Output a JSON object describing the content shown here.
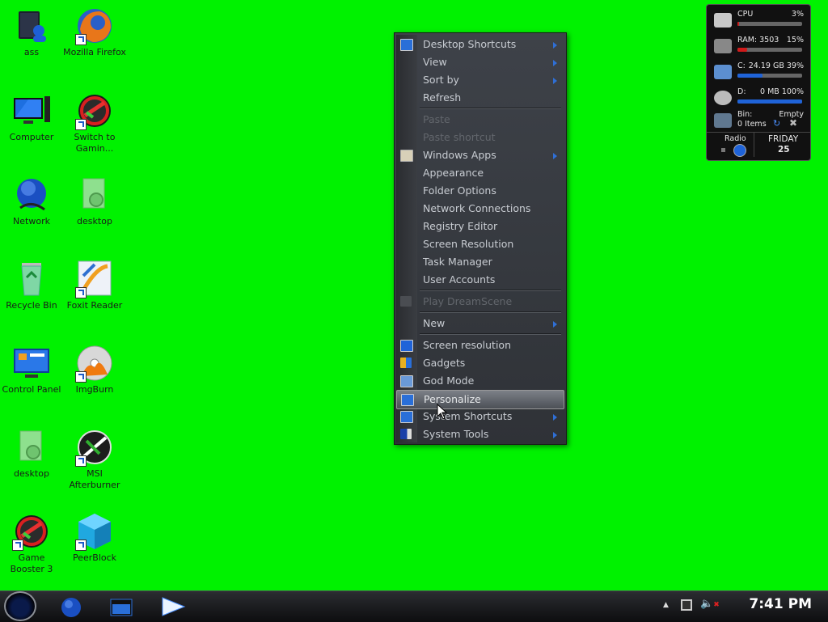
{
  "desktop_icons": [
    {
      "id": "ass",
      "label": "ass",
      "icon": "user-folder-icon",
      "shortcut": false
    },
    {
      "id": "mozilla-firefox",
      "label": "Mozilla Firefox",
      "icon": "firefox-icon",
      "shortcut": true
    },
    {
      "id": "computer",
      "label": "Computer",
      "icon": "computer-icon",
      "shortcut": false
    },
    {
      "id": "switch-to-gaming",
      "label": "Switch to Gamin...",
      "icon": "game-booster-icon",
      "shortcut": true
    },
    {
      "id": "network",
      "label": "Network",
      "icon": "network-globe-icon",
      "shortcut": false
    },
    {
      "id": "desktop-1",
      "label": "desktop",
      "icon": "gear-file-icon",
      "shortcut": false
    },
    {
      "id": "recycle-bin",
      "label": "Recycle Bin",
      "icon": "recycle-bin-icon",
      "shortcut": false
    },
    {
      "id": "foxit-reader",
      "label": "Foxit Reader",
      "icon": "foxit-icon",
      "shortcut": true
    },
    {
      "id": "control-panel",
      "label": "Control Panel",
      "icon": "control-panel-icon",
      "shortcut": false
    },
    {
      "id": "imgburn",
      "label": "ImgBurn",
      "icon": "disc-flame-icon",
      "shortcut": true
    },
    {
      "id": "desktop-2",
      "label": "desktop",
      "icon": "gear-file-icon",
      "shortcut": false
    },
    {
      "id": "msi-afterburner",
      "label": "MSI Afterburner",
      "icon": "afterburner-icon",
      "shortcut": true
    },
    {
      "id": "game-booster-3",
      "label": "Game Booster 3",
      "icon": "game-booster-icon",
      "shortcut": true
    },
    {
      "id": "peerblock",
      "label": "PeerBlock",
      "icon": "cube-icon",
      "shortcut": true
    }
  ],
  "context_menu": {
    "items": [
      {
        "label": "Desktop Shortcuts",
        "disabled": false,
        "submenu": true,
        "icon": "monitor-check-icon"
      },
      {
        "label": "View",
        "disabled": false,
        "submenu": true,
        "icon": ""
      },
      {
        "label": "Sort by",
        "disabled": false,
        "submenu": true,
        "icon": ""
      },
      {
        "label": "Refresh",
        "disabled": false,
        "submenu": false,
        "icon": ""
      },
      {
        "label": "Paste",
        "disabled": true,
        "submenu": false,
        "icon": ""
      },
      {
        "label": "Paste shortcut",
        "disabled": true,
        "submenu": false,
        "icon": ""
      },
      {
        "label": "Windows Apps",
        "disabled": false,
        "submenu": true,
        "icon": "apps-icon"
      },
      {
        "label": "Appearance",
        "disabled": false,
        "submenu": false,
        "icon": ""
      },
      {
        "label": "Folder Options",
        "disabled": false,
        "submenu": false,
        "icon": ""
      },
      {
        "label": "Network Connections",
        "disabled": false,
        "submenu": false,
        "icon": ""
      },
      {
        "label": "Registry Editor",
        "disabled": false,
        "submenu": false,
        "icon": ""
      },
      {
        "label": "Screen Resolution",
        "disabled": false,
        "submenu": false,
        "icon": ""
      },
      {
        "label": "Task Manager",
        "disabled": false,
        "submenu": false,
        "icon": ""
      },
      {
        "label": "User Accounts",
        "disabled": false,
        "submenu": false,
        "icon": ""
      },
      {
        "label": "Play DreamScene",
        "disabled": true,
        "submenu": false,
        "icon": "dreamscene-icon"
      },
      {
        "label": "New",
        "disabled": false,
        "submenu": true,
        "icon": ""
      },
      {
        "label": "Screen resolution",
        "disabled": false,
        "submenu": false,
        "icon": "monitor-icon"
      },
      {
        "label": "Gadgets",
        "disabled": false,
        "submenu": false,
        "icon": "gadgets-icon"
      },
      {
        "label": "God Mode",
        "disabled": false,
        "submenu": false,
        "icon": "god-mode-icon"
      },
      {
        "label": "Personalize",
        "disabled": false,
        "submenu": false,
        "icon": "personalize-icon",
        "hover": true
      },
      {
        "label": "System Shortcuts",
        "disabled": false,
        "submenu": true,
        "icon": "check-icon"
      },
      {
        "label": "System Tools",
        "disabled": false,
        "submenu": true,
        "icon": "tools-icon"
      }
    ]
  },
  "gadget": {
    "cpu": {
      "label": "CPU",
      "value": "3%",
      "fill": 0.03
    },
    "ram": {
      "label": "RAM: 3503",
      "value": "15%",
      "fill": 0.15
    },
    "c_drive": {
      "label": "C:",
      "value": "24.19 GB 39%",
      "fill": 0.39
    },
    "d_drive": {
      "label": "D:",
      "value": "0 MB 100%",
      "fill": 1.0
    },
    "bin": {
      "label": "Bin:",
      "status": "Empty",
      "items": "0 Items"
    },
    "radio": {
      "label": "Radio"
    },
    "date": {
      "day": "FRIDAY",
      "number": "25"
    }
  },
  "taskbar": {
    "clock": "7:41 PM"
  },
  "colors": {
    "desktop": "#00f200",
    "menu_bg": "#35383d",
    "accent_blue": "#2f6fd6",
    "bar_red": "#d01a1a",
    "bar_blue": "#1f63d8"
  }
}
